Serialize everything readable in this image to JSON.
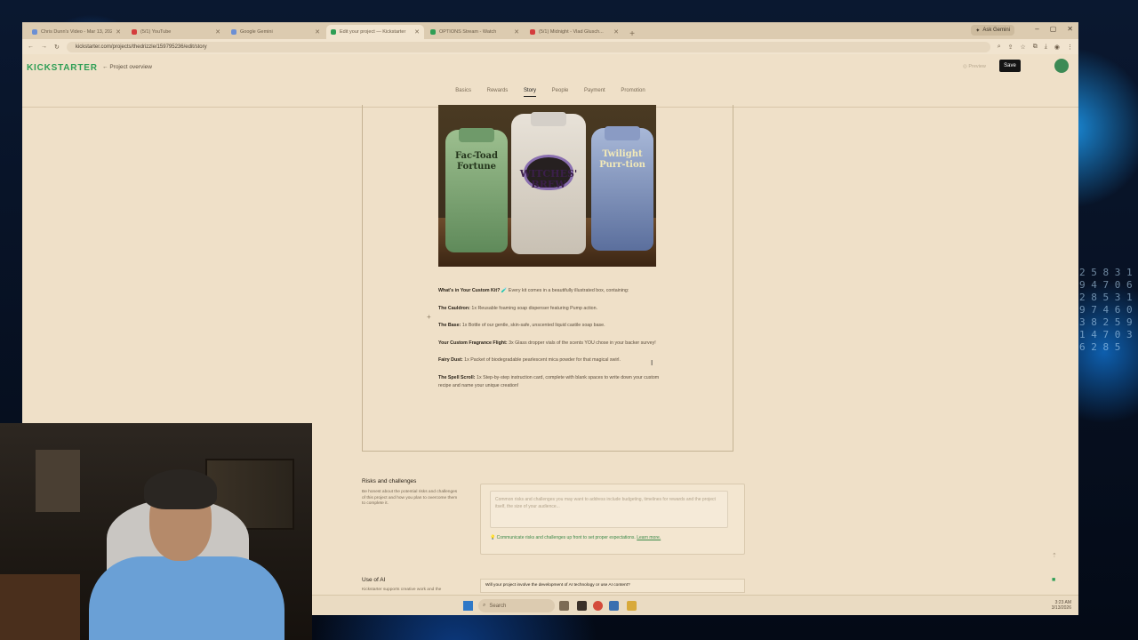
{
  "browser": {
    "tabs": [
      {
        "label": "Chris Dunn's Video - Mar 13, 2026",
        "color": "#6b8fd4"
      },
      {
        "label": "(5/1) YouTube",
        "color": "#d43c3c"
      },
      {
        "label": "Google Gemini",
        "color": "#6b8fd4"
      },
      {
        "label": "Edit your project — Kickstarter",
        "color": "#2e9e55"
      },
      {
        "label": "OPTIONS Stream - Watch",
        "color": "#2e9e55"
      },
      {
        "label": "(5/1) Midnight - Vlad Glusch...",
        "color": "#d43c3c"
      }
    ],
    "new_tab": "+",
    "ask_gemini": "Ask Gemini",
    "url": "kickstarter.com/projects/thedrizzle/159795236/edit/story"
  },
  "kickstarter": {
    "logo": "KICKSTARTER",
    "project_overview": "Project overview",
    "preview": "Preview",
    "save": "Save",
    "steps": [
      "Basics",
      "Rewards",
      "Story",
      "People",
      "Payment",
      "Promotion"
    ],
    "active_step": "Story"
  },
  "image": {
    "left_label": "Fac-Toad Fortune",
    "center_label": "WITCHES' BREW",
    "right_label": "Twilight Purr-tion"
  },
  "story": {
    "intro_heading": "What's in Your Custom Kit?",
    "intro_emoji": "🧪",
    "intro_text": "Every kit comes in a beautifully illustrated box, containing:",
    "items": [
      {
        "title": "The Cauldron:",
        "text": "1x Reusable foaming soap dispenser featuring Pump action."
      },
      {
        "title": "The Base:",
        "text": "1x Bottle of our gentle, skin-safe, unscented liquid castile soap base."
      },
      {
        "title": "Your Custom Fragrance Flight:",
        "text": "3x Glass dropper vials of the scents YOU chose in your backer survey!"
      },
      {
        "title": "Fairy Dust:",
        "text": "1x Packet of biodegradable pearlescent mica powder for that magical swirl."
      },
      {
        "title": "The Spell Scroll:",
        "text": "1x Step-by-step instruction card, complete with blank spaces to write down your custom recipe and name your unique creation!"
      }
    ]
  },
  "risks": {
    "title": "Risks and challenges",
    "description": "Be honest about the potential risks and challenges of this project and how you plan to overcome them to complete it.",
    "placeholder": "Common risks and challenges you may want to address include budgeting, timelines for rewards and the project itself, the size of your audience...",
    "tip": "Communicate risks and challenges up front to set proper expectations.",
    "learn_more": "Learn more."
  },
  "ai": {
    "title": "Use of AI",
    "description": "Kickstarter supports creative work and the",
    "question": "Will your project involve the development of AI technology or use AI content?"
  },
  "taskbar": {
    "search": "Search",
    "time": "3:23 AM",
    "date": "3/13/2026"
  },
  "matrix_glyphs": "2 5 8 3 1 9 4 7 0 6 2 8 5 3 1 9 7 4 6 0 3 8 2 5 9 1 4 7 0 3 6 2 8 5"
}
